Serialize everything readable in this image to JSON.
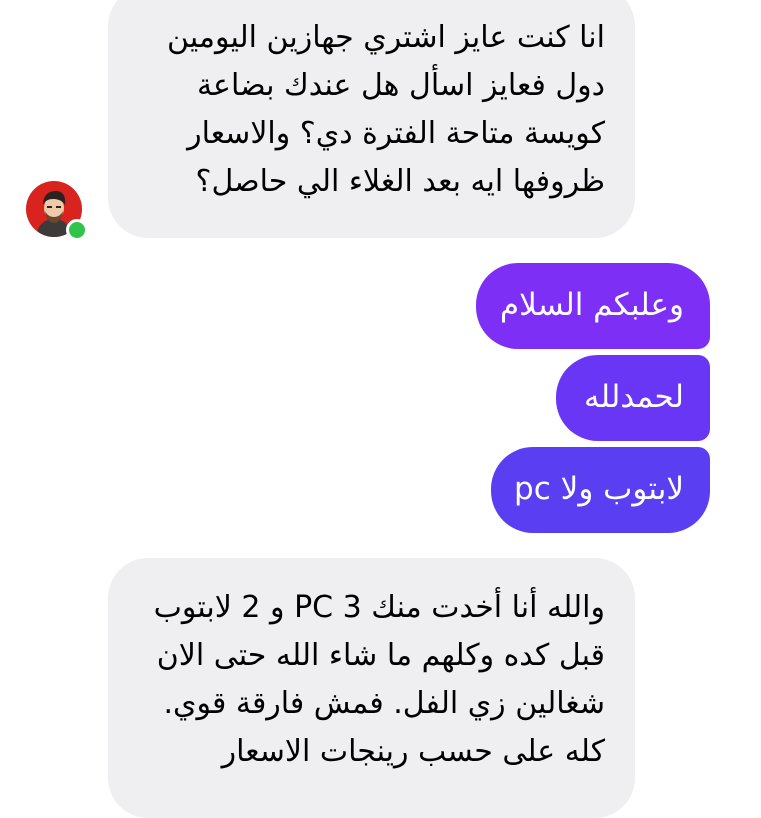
{
  "messages": [
    {
      "direction": "incoming",
      "text": "انا كنت عايز اشتري جهازين اليومين\nدول فعايز اسأل هل عندك بضاعة\nكويسة متاحة الفترة دي؟ والاسعار\nظروفها ايه بعد الغلاء الي حاصل؟"
    },
    {
      "direction": "outgoing",
      "text": "وعلبكم السلام"
    },
    {
      "direction": "outgoing",
      "text": "لحمدلله"
    },
    {
      "direction": "outgoing",
      "text": "لابتوب ولا pc"
    },
    {
      "direction": "incoming",
      "text": "والله أنا أخدت منك 3 PC و 2 لابتوب\nقبل كده وكلهم ما شاء الله حتى الان\nشغالين زي الفل. فمش فارقة قوي.\nكله على حسب رينجات الاسعار"
    }
  ],
  "contact": {
    "avatar_icon": "avatar-icon",
    "status": "online",
    "status_color": "#31c44a"
  },
  "colors": {
    "incoming_bubble": "#efeff1",
    "outgoing_bubble_top": "#7d2ff6",
    "outgoing_bubble_middle": "#6a36f5",
    "outgoing_bubble_bottom": "#5a3ff2"
  }
}
